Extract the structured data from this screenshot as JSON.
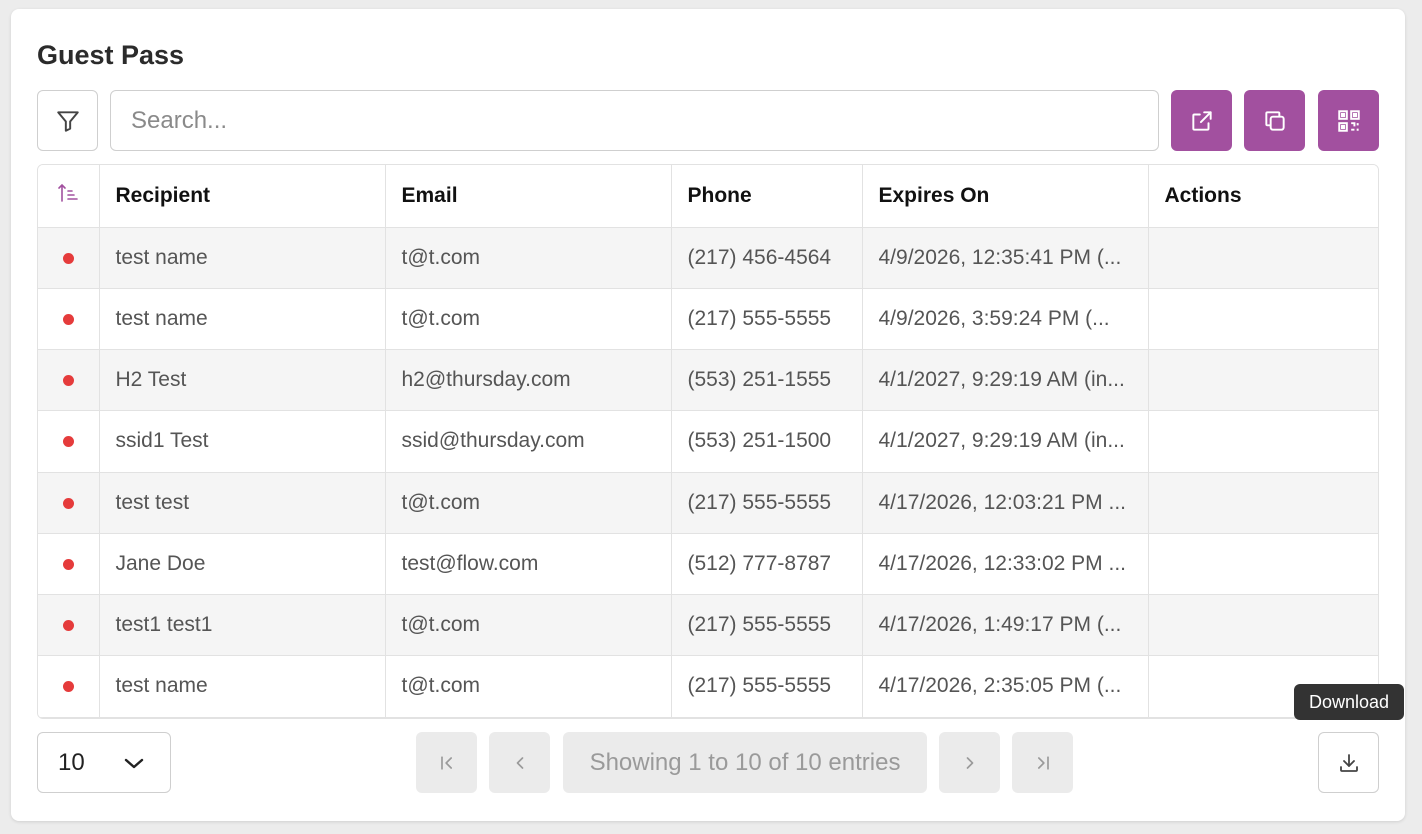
{
  "header": {
    "title": "Guest Pass"
  },
  "search": {
    "placeholder": "Search..."
  },
  "table": {
    "columns": [
      "Recipient",
      "Email",
      "Phone",
      "Expires On",
      "Actions"
    ],
    "rows": [
      {
        "status": "red",
        "recipient": "test name",
        "email": "t@t.com",
        "phone": "(217) 456-4564",
        "expires": "4/9/2026, 12:35:41 PM (...",
        "actions": ""
      },
      {
        "status": "red",
        "recipient": "test name",
        "email": "t@t.com",
        "phone": "(217) 555-5555",
        "expires": "4/9/2026, 3:59:24 PM (...",
        "actions": ""
      },
      {
        "status": "red",
        "recipient": "H2 Test",
        "email": "h2@thursday.com",
        "phone": "(553) 251-1555",
        "expires": "4/1/2027, 9:29:19 AM (in...",
        "actions": ""
      },
      {
        "status": "red",
        "recipient": "ssid1 Test",
        "email": "ssid@thursday.com",
        "phone": "(553) 251-1500",
        "expires": "4/1/2027, 9:29:19 AM (in...",
        "actions": ""
      },
      {
        "status": "red",
        "recipient": "test test",
        "email": "t@t.com",
        "phone": "(217) 555-5555",
        "expires": "4/17/2026, 12:03:21 PM ...",
        "actions": ""
      },
      {
        "status": "red",
        "recipient": "Jane Doe",
        "email": "test@flow.com",
        "phone": "(512) 777-8787",
        "expires": "4/17/2026, 12:33:02 PM ...",
        "actions": ""
      },
      {
        "status": "red",
        "recipient": "test1 test1",
        "email": "t@t.com",
        "phone": "(217) 555-5555",
        "expires": "4/17/2026, 1:49:17 PM (...",
        "actions": ""
      },
      {
        "status": "red",
        "recipient": "test name",
        "email": "t@t.com",
        "phone": "(217) 555-5555",
        "expires": "4/17/2026, 2:35:05 PM (...",
        "actions": ""
      }
    ]
  },
  "pagination": {
    "page_size": "10",
    "showing": "Showing 1 to 10 of 10 entries"
  },
  "tooltip": {
    "download": "Download"
  },
  "icons": {
    "filter": "filter-icon",
    "open_external": "external-link-icon",
    "copy": "copy-icon",
    "qr": "qr-code-icon",
    "sort": "sort-ascending-icon",
    "first_page": "first-page-icon",
    "prev_page": "chevron-left-icon",
    "next_page": "chevron-right-icon",
    "last_page": "last-page-icon",
    "download": "download-icon",
    "dropdown": "chevron-down-icon"
  },
  "colors": {
    "accent": "#a2509f",
    "status_red": "#e53b3b",
    "row_alt": "#f5f5f5"
  }
}
